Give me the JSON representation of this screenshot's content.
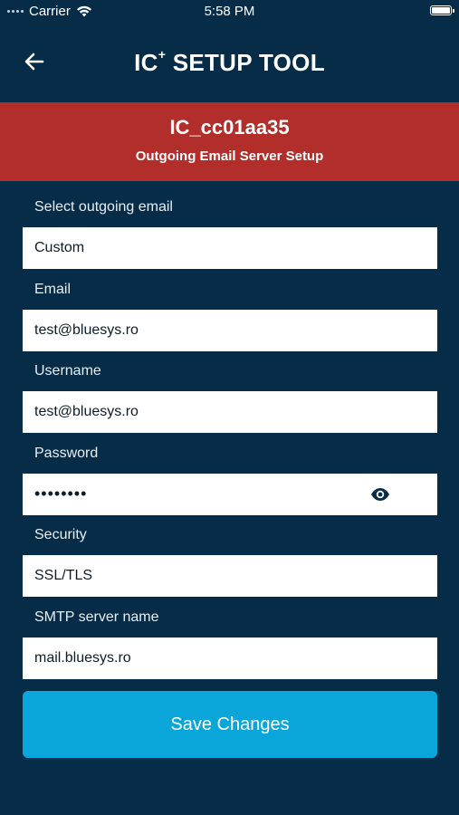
{
  "status_bar": {
    "carrier": "Carrier",
    "time": "5:58 PM"
  },
  "header": {
    "title_main": "IC",
    "title_sup": "+",
    "title_rest": " SETUP TOOL",
    "back_icon": "arrow-left-icon"
  },
  "banner": {
    "device_id": "IC_cc01aa35",
    "subtitle": "Outgoing Email Server Setup",
    "color": "#b22e2b"
  },
  "form": {
    "select_email": {
      "label": "Select outgoing email",
      "value": "Custom"
    },
    "email": {
      "label": "Email",
      "value": "test@bluesys.ro"
    },
    "username": {
      "label": "Username",
      "value": "test@bluesys.ro"
    },
    "password": {
      "label": "Password",
      "value": "••••••••",
      "toggle_icon": "eye-icon"
    },
    "security": {
      "label": "Security",
      "value": "SSL/TLS"
    },
    "smtp_server": {
      "label": "SMTP server name",
      "value": "mail.bluesys.ro"
    }
  },
  "actions": {
    "save_label": "Save Changes",
    "save_color": "#0aa6d9"
  },
  "theme": {
    "background": "#062c48"
  }
}
